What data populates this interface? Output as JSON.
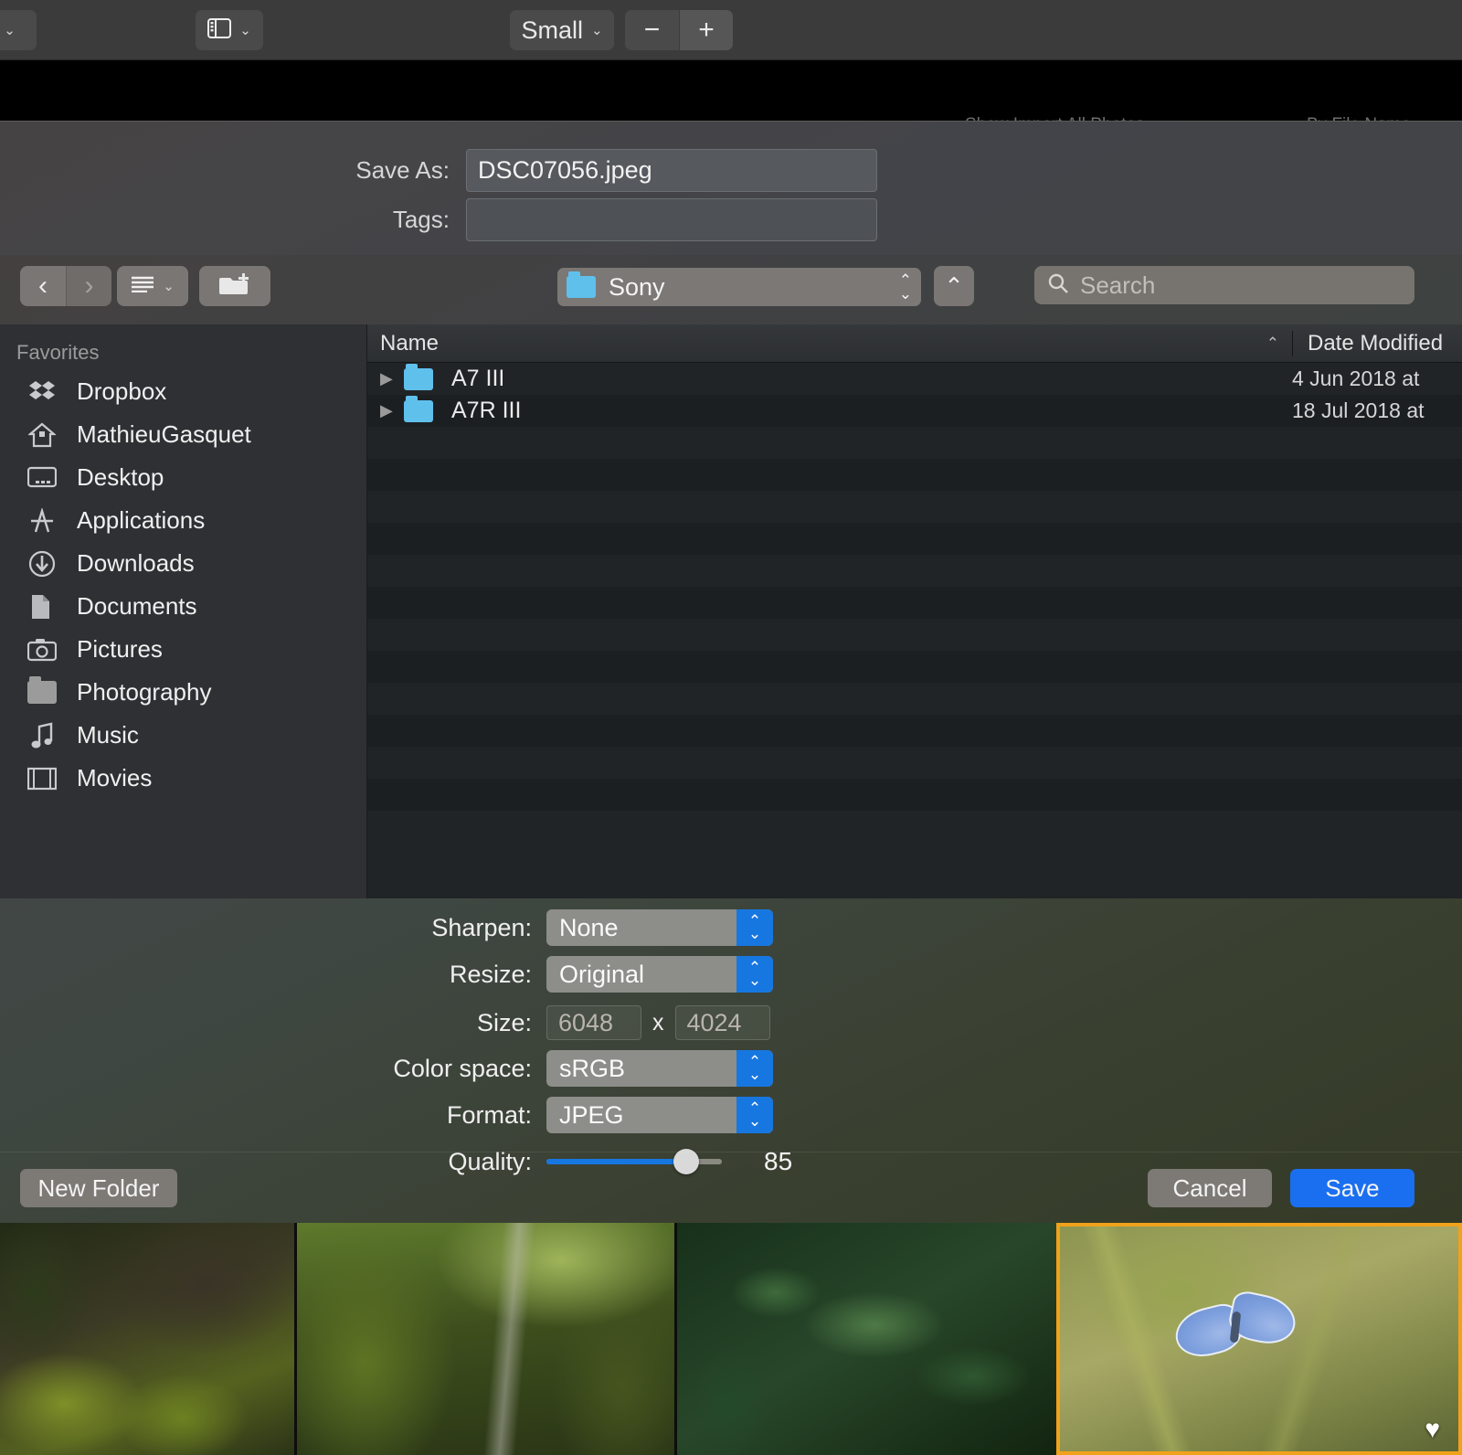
{
  "app_toolbar": {
    "left_menu_label": "",
    "left_menu_chevron": "⌄",
    "sidebar_toggle_icon": "sidebar-icon",
    "sidebar_chevron": "⌄",
    "size_popup_label": "Small",
    "size_popup_chevron": "⌄",
    "zoom_out_label": "−",
    "zoom_in_label": "+"
  },
  "background_text": {
    "fragment_left": "Show Import All Photos",
    "fragment_right": "By File Name"
  },
  "save_sheet": {
    "save_as_label": "Save As:",
    "save_as_value": "DSC07056.jpeg",
    "tags_label": "Tags:",
    "tags_value": "",
    "tags_placeholder": "",
    "nav": {
      "back_icon": "chevron-left-icon",
      "back_glyph": "‹",
      "forward_icon": "chevron-right-icon",
      "forward_glyph": "›",
      "view_menu_icon": "list-view-icon",
      "view_menu_chevron": "⌄",
      "new_folder_icon": "new-folder-icon",
      "location_label": "Sony",
      "location_stepper": "⌃⌄",
      "up_button_glyph": "⌃",
      "search_icon": "search-icon",
      "search_placeholder": "Search",
      "search_value": ""
    },
    "sidebar": {
      "header": "Favorites",
      "items": [
        {
          "label": "Dropbox",
          "icon": "dropbox-icon"
        },
        {
          "label": "MathieuGasquet",
          "icon": "home-icon"
        },
        {
          "label": "Desktop",
          "icon": "desktop-icon"
        },
        {
          "label": "Applications",
          "icon": "applications-icon"
        },
        {
          "label": "Downloads",
          "icon": "downloads-icon"
        },
        {
          "label": "Documents",
          "icon": "documents-icon"
        },
        {
          "label": "Pictures",
          "icon": "pictures-icon"
        },
        {
          "label": "Photography",
          "icon": "folder-icon"
        },
        {
          "label": "Music",
          "icon": "music-icon"
        },
        {
          "label": "Movies",
          "icon": "movies-icon"
        }
      ]
    },
    "file_list": {
      "columns": {
        "name": "Name",
        "date_modified": "Date Modified"
      },
      "sort_caret": "⌃",
      "rows": [
        {
          "disclosure": "▶",
          "icon": "folder-icon",
          "name": "A7 III",
          "date_modified": "4 Jun 2018 at"
        },
        {
          "disclosure": "▶",
          "icon": "folder-icon",
          "name": "A7R III",
          "date_modified": "18 Jul 2018 at"
        }
      ]
    },
    "options": {
      "sharpen_label": "Sharpen:",
      "sharpen_value": "None",
      "resize_label": "Resize:",
      "resize_value": "Original",
      "size_label": "Size:",
      "size_width": "6048",
      "size_separator": "x",
      "size_height": "4024",
      "colorspace_label": "Color space:",
      "colorspace_value": "sRGB",
      "format_label": "Format:",
      "format_value": "JPEG",
      "quality_label": "Quality:",
      "quality_value": "85",
      "quality_percent": 85,
      "stepper_glyph_up": "⌃",
      "stepper_glyph_down": "⌄"
    },
    "footer": {
      "new_folder_label": "New Folder",
      "cancel_label": "Cancel",
      "save_label": "Save"
    }
  },
  "filmstrip": {
    "thumbnails": [
      {
        "name": "mossy-rocks-photo",
        "selected": false,
        "favorite": false
      },
      {
        "name": "forest-path-photo",
        "selected": false,
        "favorite": false
      },
      {
        "name": "wet-leaves-photo",
        "selected": false,
        "favorite": false
      },
      {
        "name": "blue-butterfly-photo",
        "selected": true,
        "favorite": true
      }
    ],
    "favorite_glyph": "♥"
  },
  "colors": {
    "accent_blue": "#1a6ff0",
    "stepper_blue": "#1777e0",
    "selection_orange": "#f0a21c",
    "folder_blue": "#5fc0ec"
  }
}
